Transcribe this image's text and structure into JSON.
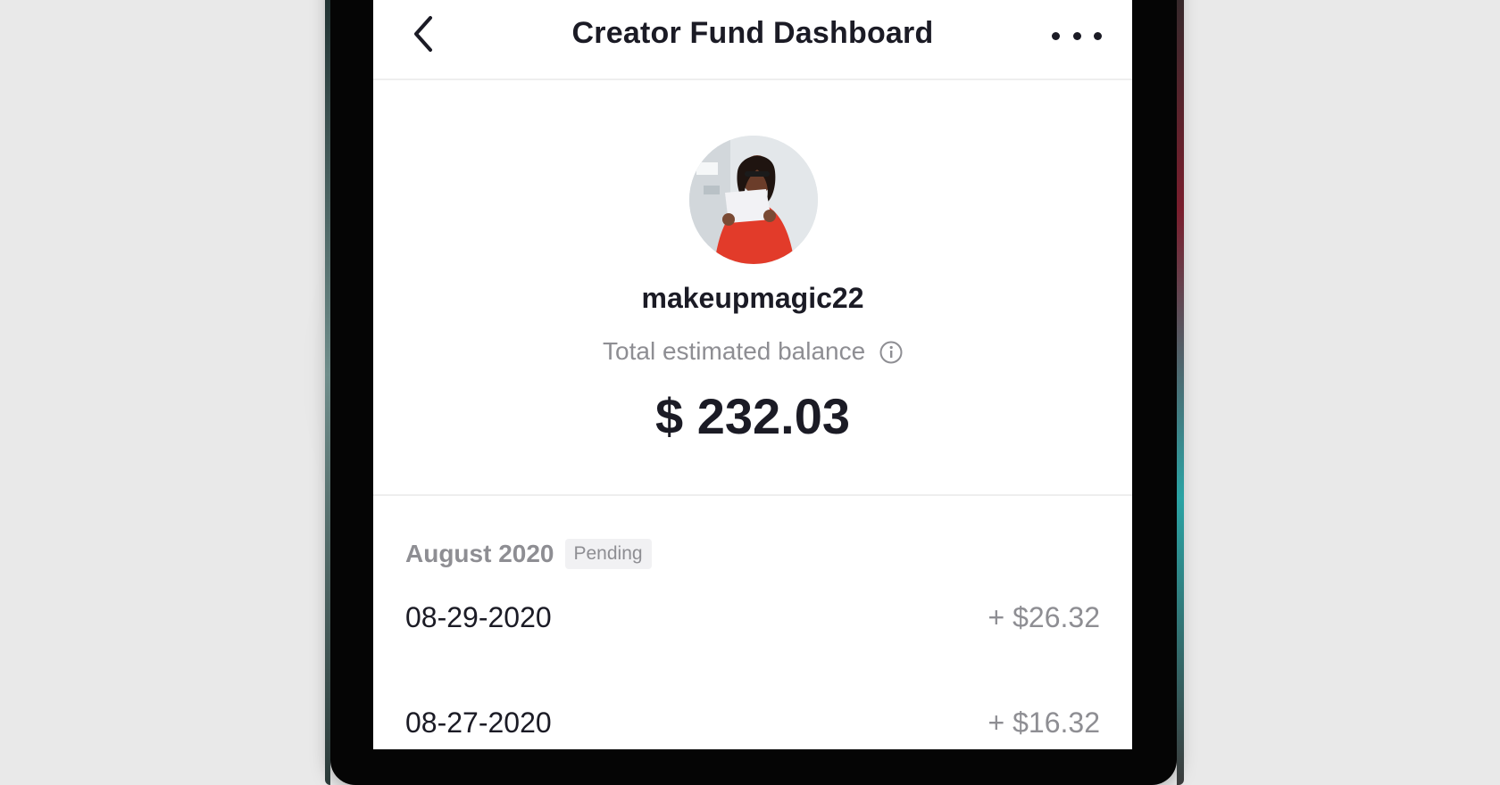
{
  "header": {
    "title": "Creator Fund Dashboard",
    "back_icon": "chevron-left-icon",
    "more_icon": "more-horizontal-icon"
  },
  "profile": {
    "username": "makeupmagic22",
    "balance_label": "Total estimated balance",
    "balance_amount": "$ 232.03",
    "info_icon": "info-icon",
    "avatar": "profile-photo"
  },
  "earnings": {
    "month": "August 2020",
    "status_badge": "Pending",
    "entries": [
      {
        "date": "08-29-2020",
        "amount": "+ $26.32"
      },
      {
        "date": "08-27-2020",
        "amount": "+ $16.32"
      }
    ]
  },
  "colors": {
    "text_primary": "#1b1b25",
    "text_secondary": "#8e8e93",
    "divider": "#eeeeee",
    "badge_bg": "#f1f1f3"
  }
}
